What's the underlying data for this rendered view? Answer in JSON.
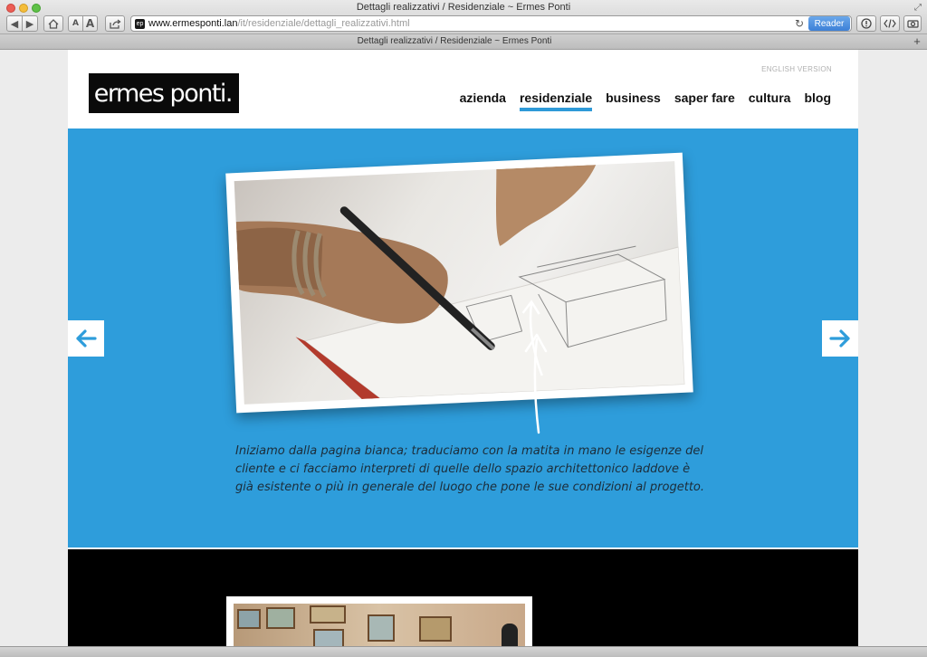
{
  "browser": {
    "window_title": "Dettagli realizzativi / Residenziale ~ Ermes Ponti",
    "tab_title": "Dettagli realizzativi / Residenziale ~ Ermes Ponti",
    "url_host": "www.ermesponti.lan",
    "url_path": "/it/residenziale/dettagli_realizzativi.html",
    "reader_label": "Reader",
    "font_small_label": "A",
    "font_big_label": "A"
  },
  "site": {
    "logo_text": "ermes ponti.",
    "language_link": "ENGLISH VERSION",
    "nav": [
      {
        "label": "azienda"
      },
      {
        "label": "residenziale"
      },
      {
        "label": "business"
      },
      {
        "label": "saper fare"
      },
      {
        "label": "cultura"
      },
      {
        "label": "blog"
      }
    ],
    "active_nav": "residenziale",
    "accent_color": "#2e9ddb"
  },
  "hero": {
    "caption": "Iniziamo dalla pagina bianca; traduciamo con la matita in mano le esigenze del cliente e ci facciamo interpreti di quelle dello spazio architettonico laddove è già esistente o più in generale del luogo che pone le sue condizioni al progetto.",
    "prev_icon": "arrow-left-icon",
    "next_icon": "arrow-right-icon"
  }
}
